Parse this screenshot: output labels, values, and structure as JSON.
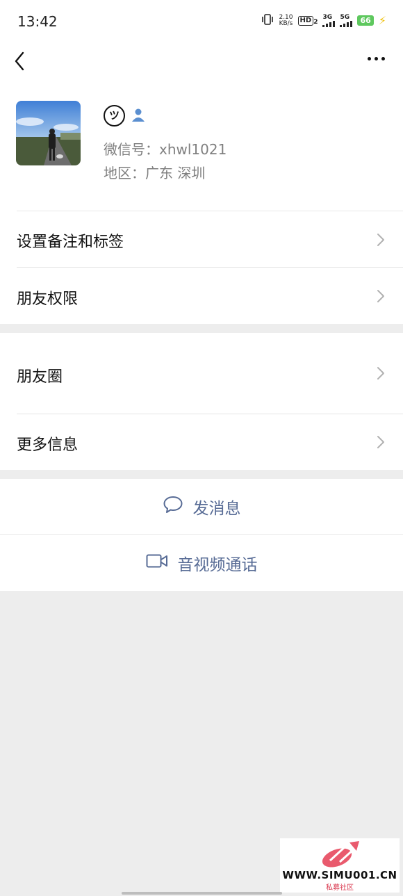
{
  "status_bar": {
    "time": "13:42",
    "speed_value": "2.10",
    "speed_unit": "KB/s",
    "hd_label": "HD",
    "hd_sub": "2",
    "net1": "3G",
    "net2": "5G",
    "battery": "66"
  },
  "nav": {
    "back_icon": "chevron-left-icon",
    "more_icon": "ellipsis-icon"
  },
  "profile": {
    "nickname_symbol": "ツ",
    "wechat_id": "微信号：xhwl1021",
    "region": "地区：广东  深圳"
  },
  "menu": {
    "items": [
      {
        "label": "设置备注和标签"
      },
      {
        "label": "朋友权限"
      },
      {
        "label": "朋友圈"
      },
      {
        "label": "更多信息"
      }
    ]
  },
  "actions": {
    "message": "发消息",
    "video_call": "音视频通话"
  },
  "watermark": {
    "site": "WWW.SIMU001.CN",
    "name": "私募社区"
  },
  "colors": {
    "link": "#576b95",
    "background": "#ededed",
    "battery": "#5ec85e"
  }
}
